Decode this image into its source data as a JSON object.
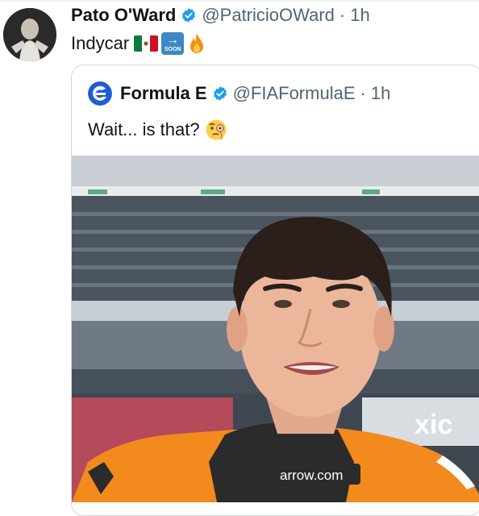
{
  "tweet": {
    "display_name": "Pato O'Ward",
    "handle": "@PatricioOWard",
    "separator": "·",
    "time": "1h",
    "text": "Indycar",
    "emojis": [
      "mexico-flag",
      "soon-arrow",
      "fire"
    ],
    "soon_label": "SOON"
  },
  "quoted_tweet": {
    "display_name": "Formula E",
    "handle": "@FIAFormulaE",
    "separator": "·",
    "time": "1h",
    "text": "Wait... is that?",
    "emoji": "face-with-monocle",
    "media": {
      "jersey_text": "arrow.com",
      "banner_text": "xic"
    }
  },
  "colors": {
    "verified_blue": "#1d9bf0",
    "handle_gray": "#536471",
    "suit_orange": "#f28a1e",
    "fe_blue": "#1f5cd6"
  }
}
